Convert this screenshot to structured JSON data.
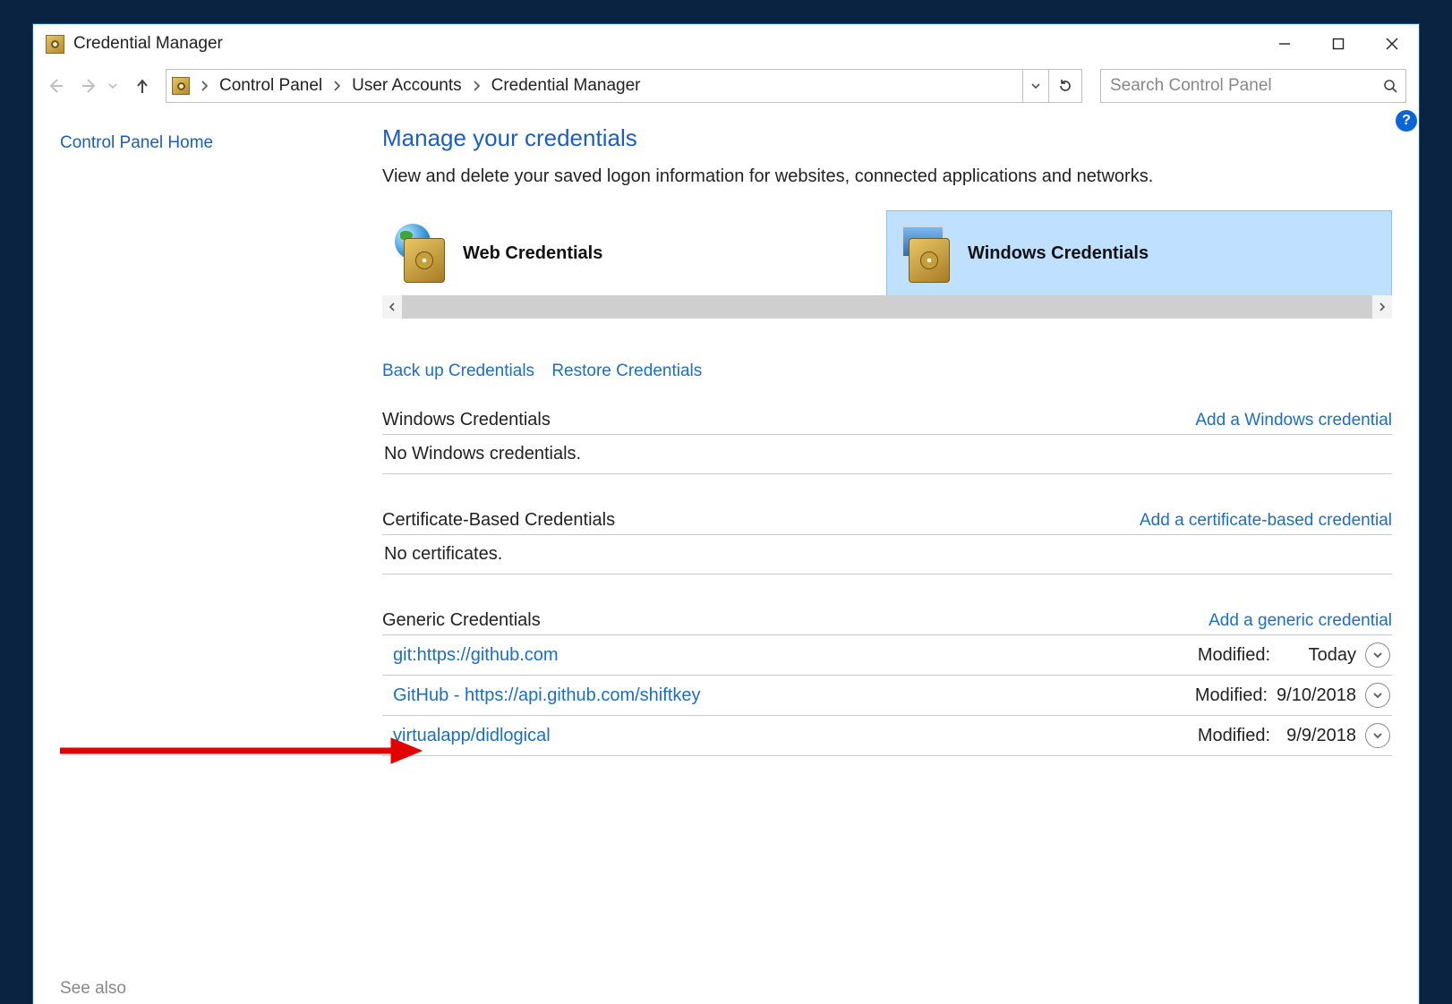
{
  "window": {
    "title": "Credential Manager"
  },
  "breadcrumbs": [
    "Control Panel",
    "User Accounts",
    "Credential Manager"
  ],
  "search": {
    "placeholder": "Search Control Panel"
  },
  "sidebar": {
    "home": "Control Panel Home",
    "see_also": "See also"
  },
  "page": {
    "title": "Manage your credentials",
    "subtitle": "View and delete your saved logon information for websites, connected applications and networks."
  },
  "tiles": {
    "web": "Web Credentials",
    "windows": "Windows Credentials"
  },
  "links": {
    "backup": "Back up Credentials",
    "restore": "Restore Credentials"
  },
  "sections": {
    "windows": {
      "label": "Windows Credentials",
      "action": "Add a Windows credential",
      "empty": "No Windows credentials."
    },
    "cert": {
      "label": "Certificate-Based Credentials",
      "action": "Add a certificate-based credential",
      "empty": "No certificates."
    },
    "generic": {
      "label": "Generic Credentials",
      "action": "Add a generic credential",
      "modified_label": "Modified:",
      "rows": [
        {
          "name": "git:https://github.com",
          "modified": "Today"
        },
        {
          "name": "GitHub - https://api.github.com/shiftkey",
          "modified": "9/10/2018"
        },
        {
          "name": "virtualapp/didlogical",
          "modified": "9/9/2018"
        }
      ]
    }
  }
}
